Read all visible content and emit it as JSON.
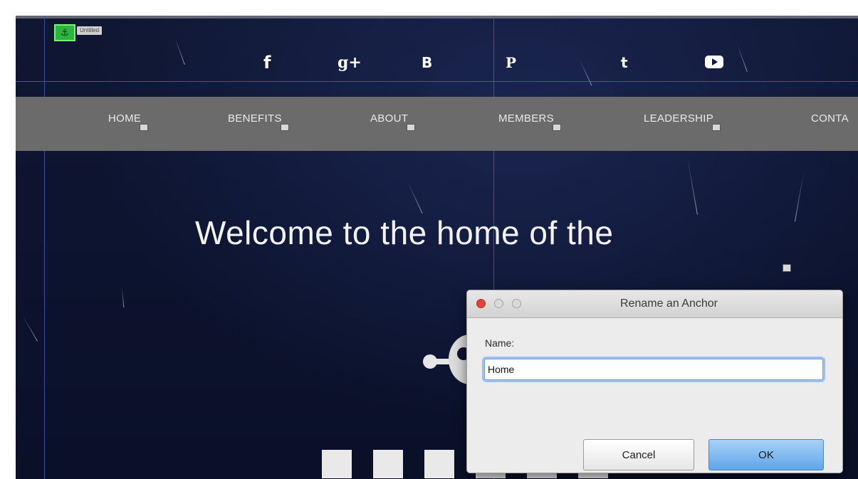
{
  "editor": {
    "anchor_badge_label": "Untitled",
    "anchor_icon": "anchor-icon"
  },
  "social_icons": [
    {
      "name": "facebook-icon",
      "glyph": "f"
    },
    {
      "name": "google-plus-icon",
      "glyph": "g+"
    },
    {
      "name": "blogger-icon",
      "glyph": "B"
    },
    {
      "name": "pinterest-icon",
      "glyph": "P"
    },
    {
      "name": "twitter-icon",
      "glyph": "t"
    },
    {
      "name": "youtube-icon",
      "glyph": "▶"
    }
  ],
  "nav": {
    "items": [
      {
        "label": "HOME"
      },
      {
        "label": "BENEFITS"
      },
      {
        "label": "ABOUT"
      },
      {
        "label": "MEMBERS"
      },
      {
        "label": "LEADERSHIP"
      },
      {
        "label": "CONTA"
      }
    ]
  },
  "hero": {
    "title": "Welcome to the home of the"
  },
  "dialog": {
    "title": "Rename an Anchor",
    "name_label": "Name:",
    "name_value": "Home",
    "cancel_label": "Cancel",
    "ok_label": "OK"
  },
  "colors": {
    "navbar": "#6b6b6b",
    "background": "#0d1430",
    "guide": "#3d5fa7",
    "anchor_badge": "#2db33f",
    "ok_button": "#5fa5ea"
  }
}
